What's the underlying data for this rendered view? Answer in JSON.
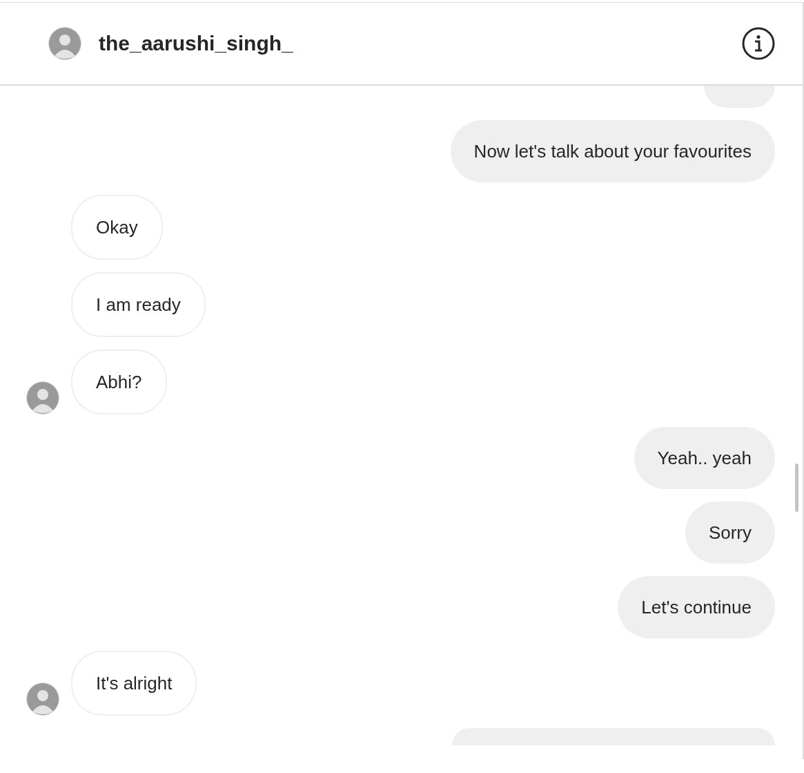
{
  "header": {
    "username": "the_aarushi_singh_"
  },
  "messages": [
    {
      "kind": "outgoing",
      "clipped_top": true
    },
    {
      "kind": "outgoing",
      "text": "Now let's talk about your favourites"
    },
    {
      "kind": "incoming",
      "text": "Okay",
      "avatar": false
    },
    {
      "kind": "incoming",
      "text": "I am ready",
      "avatar": false
    },
    {
      "kind": "incoming",
      "text": "Abhi?",
      "avatar": true
    },
    {
      "kind": "outgoing",
      "text": "Yeah.. yeah"
    },
    {
      "kind": "outgoing",
      "text": "Sorry"
    },
    {
      "kind": "outgoing",
      "text": "Let's continue"
    },
    {
      "kind": "incoming",
      "text": "It's alright",
      "avatar": true
    },
    {
      "kind": "outgoing",
      "clipped_bottom": true
    }
  ]
}
